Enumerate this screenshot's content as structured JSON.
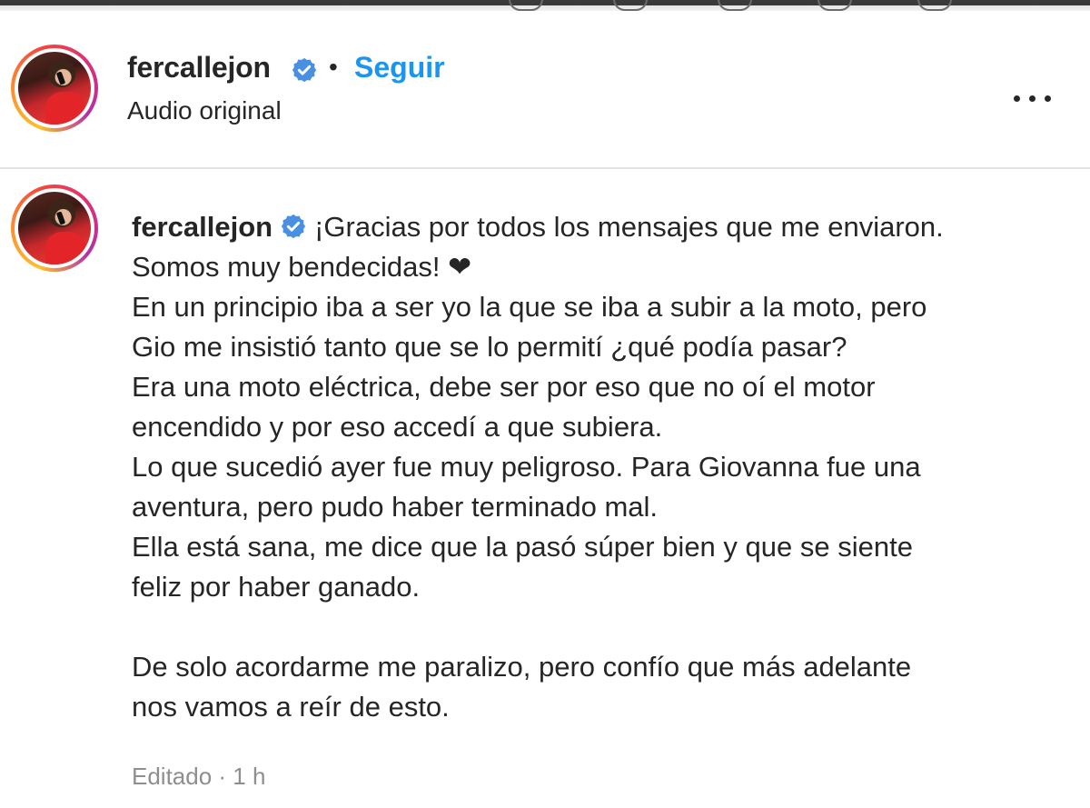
{
  "header": {
    "username": "fercallejon",
    "separator": "•",
    "follow_label": "Seguir",
    "subtitle": "Audio original",
    "more_icon": "more-options-icon"
  },
  "caption": {
    "username": "fercallejon",
    "lines": [
      "¡Gracias por todos los mensajes que me enviaron.",
      "Somos muy bendecidas! ❤",
      "En un principio iba a ser yo la que se iba a subir a la moto, pero",
      "Gio me insistió tanto que se lo permití ¿qué podía pasar?",
      "Era una moto eléctrica, debe ser por eso que no oí el motor",
      "encendido y por eso accedí a que subiera.",
      "Lo que sucedió ayer fue muy peligroso. Para Giovanna fue una",
      "aventura, pero pudo haber terminado mal.",
      "Ella está sana, me dice que la pasó súper bien y que se siente",
      "feliz por haber ganado.",
      "",
      "De solo acordarme me paralizo, pero confío que más adelante",
      "nos vamos a reír de esto."
    ],
    "meta": "Editado · 1 h"
  },
  "colors": {
    "accent": "#1a96f0",
    "verified": "#4a90e2",
    "text": "#262626",
    "muted": "#8e8e8e"
  }
}
